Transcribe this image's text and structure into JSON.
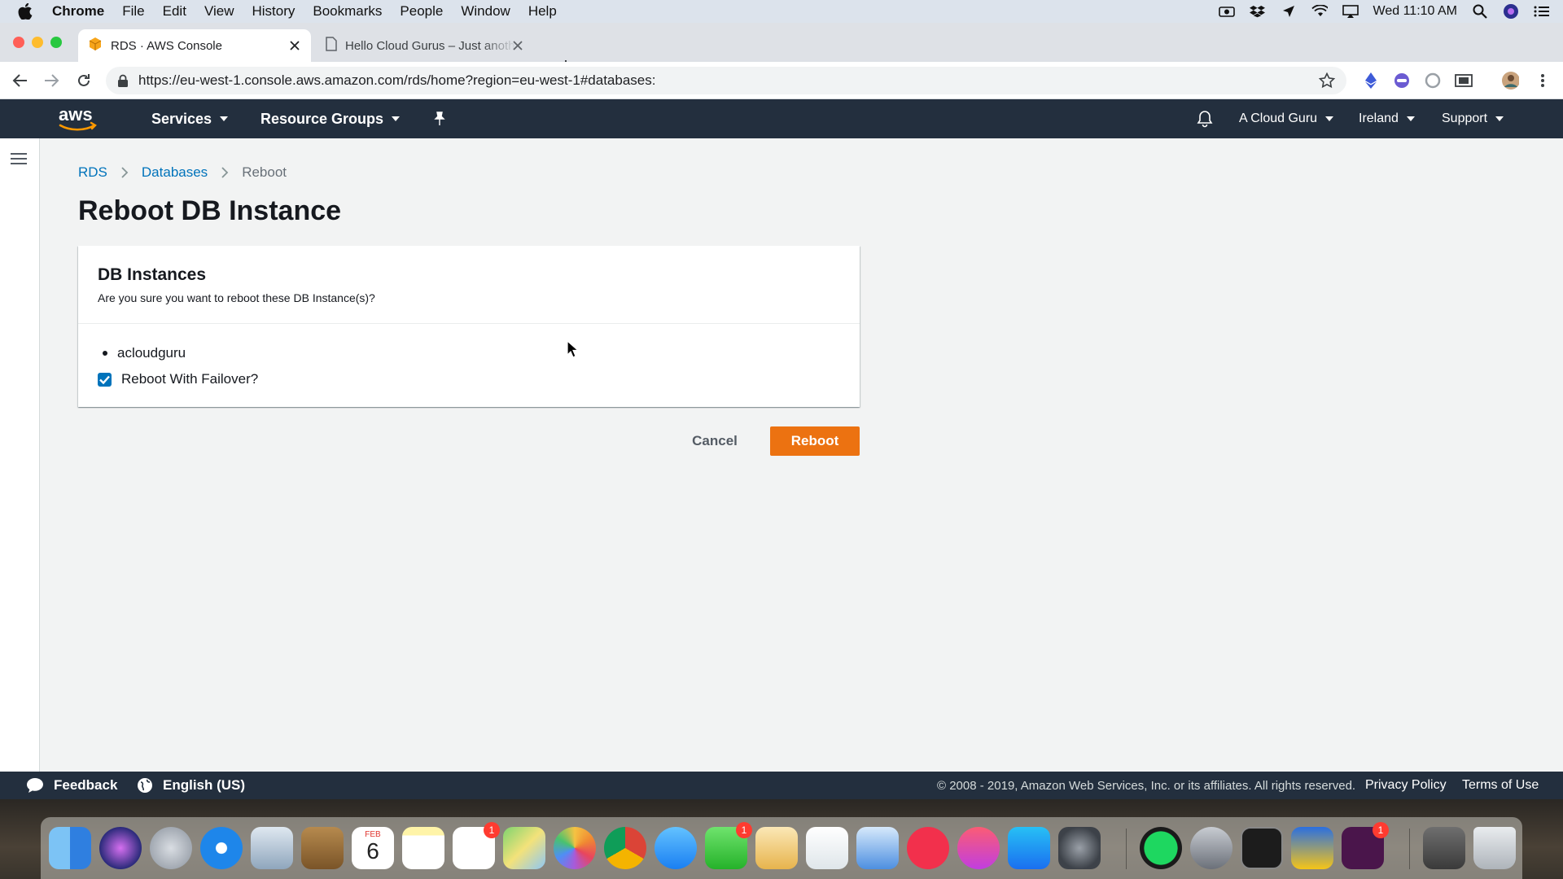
{
  "menubar": {
    "app": "Chrome",
    "items": [
      "File",
      "Edit",
      "View",
      "History",
      "Bookmarks",
      "People",
      "Window",
      "Help"
    ],
    "clock": "Wed 11:10 AM"
  },
  "tabs": [
    {
      "title": "RDS · AWS Console",
      "icon": "aws-cube-icon",
      "active": true
    },
    {
      "title": "Hello Cloud Gurus – Just another WordPress site",
      "icon": "page-icon",
      "active": false
    }
  ],
  "address_bar": {
    "url": "https://eu-west-1.console.aws.amazon.com/rds/home?region=eu-west-1#databases:"
  },
  "aws_nav": {
    "logo_text": "aws",
    "services": "Services",
    "resource_groups": "Resource Groups",
    "account": "A Cloud Guru",
    "region": "Ireland",
    "support": "Support"
  },
  "breadcrumb": {
    "rds": "RDS",
    "databases": "Databases",
    "current": "Reboot"
  },
  "page_title": "Reboot DB Instance",
  "panel": {
    "title": "DB Instances",
    "description": "Are you sure you want to reboot these DB Instance(s)?",
    "instance": "acloudguru",
    "failover_label": "Reboot With Failover?",
    "failover_checked": true
  },
  "actions": {
    "cancel": "Cancel",
    "reboot": "Reboot"
  },
  "footer": {
    "feedback": "Feedback",
    "language": "English (US)",
    "copyright": "© 2008 - 2019, Amazon Web Services, Inc. or its affiliates. All rights reserved.",
    "privacy": "Privacy Policy",
    "terms": "Terms of Use"
  },
  "dock": {
    "calendar_month": "FEB",
    "calendar_day": "6",
    "badges": {
      "reminders": "1",
      "facetime": "1",
      "slack": "1"
    }
  },
  "colors": {
    "aws_nav": "#232f3e",
    "primary_button": "#ec7211",
    "link": "#0073bb",
    "checkbox": "#0073bb"
  }
}
